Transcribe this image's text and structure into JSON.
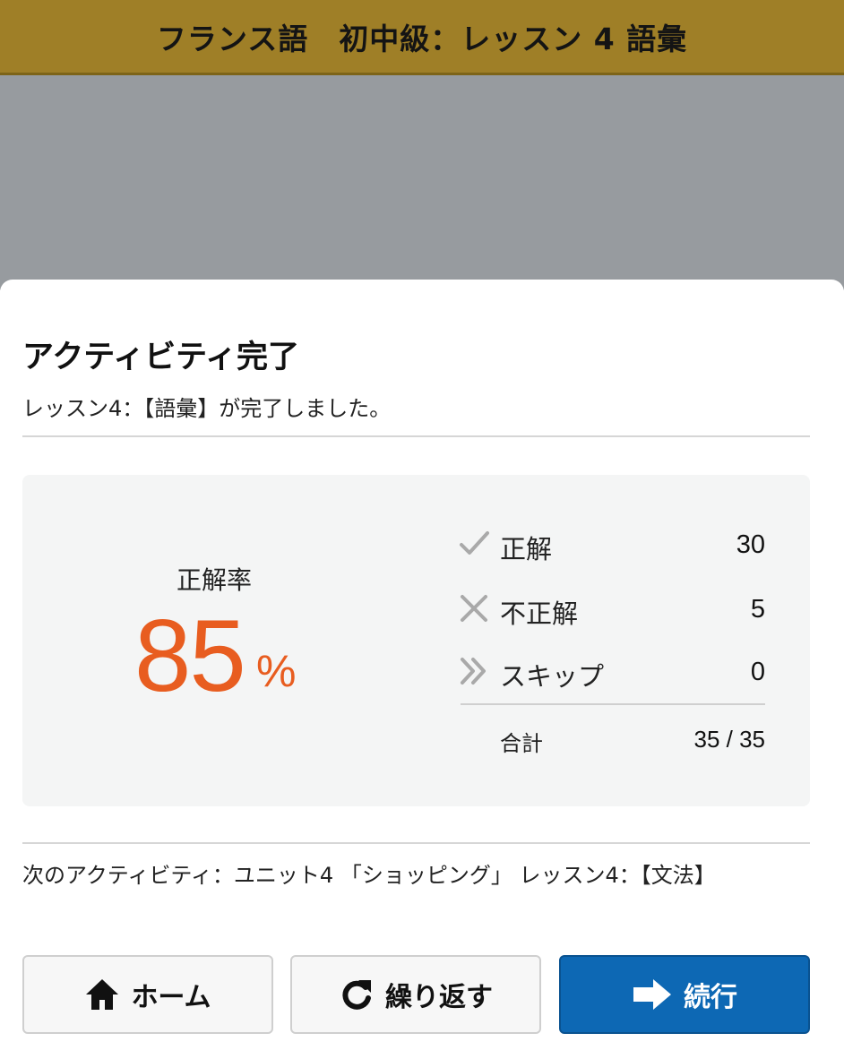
{
  "header": {
    "title": "フランス語　初中級：レッスン 4 語彙"
  },
  "dialog": {
    "title": "アクティビティ完了",
    "subtitle": "レッスン4：【語彙】が完了しました。",
    "accuracy": {
      "label": "正解率",
      "value": "85",
      "unit": "%"
    },
    "stats": [
      {
        "icon": "check-icon",
        "label": "正解",
        "value": "30"
      },
      {
        "icon": "cross-icon",
        "label": "不正解",
        "value": "5"
      },
      {
        "icon": "double-chevron-icon",
        "label": "スキップ",
        "value": "0"
      }
    ],
    "total": {
      "label": "合計",
      "value": "35 / 35"
    },
    "next_activity": "次のアクティビティ：ユニット4 「ショッピング」 レッスン4：【文法】",
    "buttons": {
      "home": {
        "label": "ホーム",
        "icon": "home-icon"
      },
      "repeat": {
        "label": "繰り返す",
        "icon": "repeat-icon"
      },
      "continue": {
        "label": "続行",
        "icon": "arrow-right-icon"
      }
    }
  },
  "colors": {
    "header_bg": "#9f7f27",
    "overlay": "#979b9f",
    "accent_orange": "#e85d20",
    "primary_button": "#0d68b4"
  }
}
